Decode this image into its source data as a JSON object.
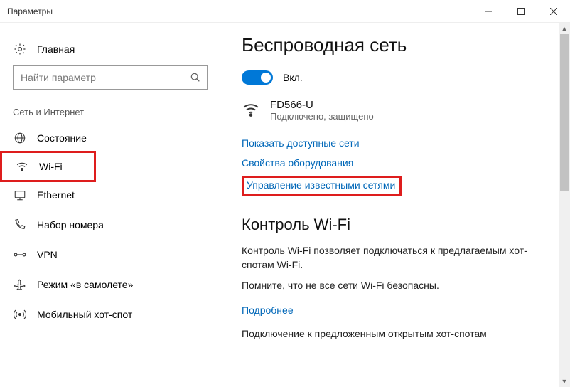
{
  "window_title": "Параметры",
  "sidebar": {
    "home": "Главная",
    "search_placeholder": "Найти параметр",
    "group": "Сеть и Интернет",
    "items": [
      {
        "label": "Состояние"
      },
      {
        "label": "Wi-Fi"
      },
      {
        "label": "Ethernet"
      },
      {
        "label": "Набор номера"
      },
      {
        "label": "VPN"
      },
      {
        "label": "Режим «в самолете»"
      },
      {
        "label": "Мобильный хот-спот"
      }
    ]
  },
  "main": {
    "heading": "Беспроводная сеть",
    "toggle_on": "Вкл.",
    "network": {
      "name": "FD566-U",
      "status": "Подключено, защищено"
    },
    "links": {
      "show_networks": "Показать доступные сети",
      "hardware_props": "Свойства оборудования",
      "manage_known": "Управление известными сетями"
    },
    "wifi_control": {
      "title": "Контроль Wi-Fi",
      "desc": "Контроль Wi-Fi позволяет подключаться к предлагаемым хот-спотам Wi-Fi.",
      "note": "Помните, что не все сети Wi-Fi безопасны.",
      "more": "Подробнее",
      "connect_suggested": "Подключение к предложенным открытым хот-спотам"
    }
  }
}
